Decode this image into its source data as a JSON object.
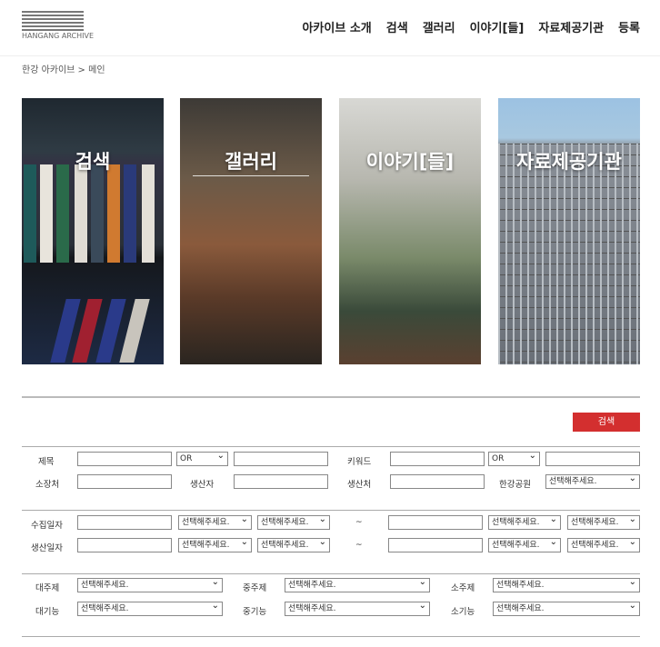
{
  "logo": {
    "text": "HANGANG ARCHIVE"
  },
  "nav": [
    "아카이브 소개",
    "검색",
    "갤러리",
    "이야기[들]",
    "자료제공기관",
    "등록"
  ],
  "breadcrumb": "한강 아카이브 > 메인",
  "cards": [
    "검색",
    "갤러리",
    "이야기[들]",
    "자료제공기관"
  ],
  "search_button": "검색",
  "form": {
    "title": "제목",
    "op1": "OR",
    "keyword": "키워드",
    "op2": "OR",
    "holder": "소장처",
    "producer": "생산자",
    "producer_place": "생산처",
    "park": "한강공원",
    "collect_date": "수집일자",
    "produce_date": "생산일자",
    "tilde": "~",
    "main_topic": "대주제",
    "mid_topic": "중주제",
    "sub_topic": "소주제",
    "main_func": "대기능",
    "mid_func": "중기능",
    "sub_func": "소기능",
    "select_placeholder": "선택해주세요."
  }
}
